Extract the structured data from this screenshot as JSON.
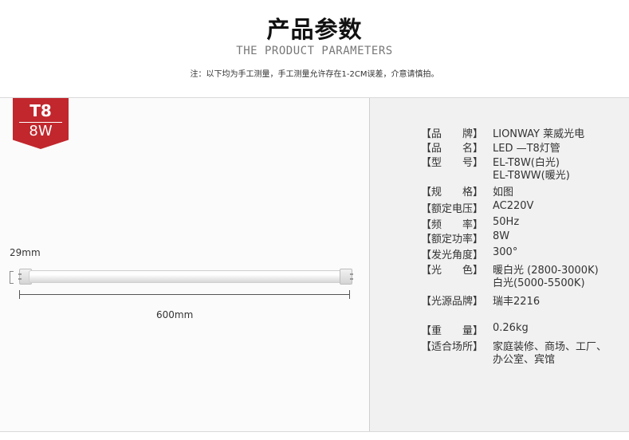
{
  "header": {
    "title_cn": "产品参数",
    "title_en": "THE PRODUCT PARAMETERS",
    "note": "注：以下均为手工测量，手工测量允许存在1-2CM误差，介意请慎拍。"
  },
  "badge": {
    "type": "T8",
    "power": "8W"
  },
  "product_image": {
    "diameter_label": "29mm",
    "length_label": "600mm"
  },
  "specs": [
    {
      "label": "【品　　牌】",
      "value": "LIONWAY 莱威光电"
    },
    {
      "label": "【品　　名】",
      "value": "LED —T8灯管"
    },
    {
      "label": "【型　　号】",
      "value": "EL-T8W(白光)",
      "value2": "EL-T8WW(暖光)"
    },
    {
      "label": "【规　　格】",
      "value": "如图"
    },
    {
      "label": "【额定电压】",
      "value": "AC220V"
    },
    {
      "label": "【频　　率】",
      "value": "50Hz"
    },
    {
      "label": "【额定功率】",
      "value": "8W"
    },
    {
      "label": "【发光角度】",
      "value": "300°"
    },
    {
      "label": "【光　　色】",
      "value": "暖白光 (2800-3000K)",
      "value2": "白光(5000-5500K)"
    },
    {
      "label": "【光源品牌】",
      "value": "瑞丰2216"
    },
    {
      "label": "【重　　量】",
      "value": "0.26kg"
    },
    {
      "label": "【适合场所】",
      "value": "家庭装修、商场、工厂、",
      "value2": "办公室、宾馆"
    }
  ]
}
